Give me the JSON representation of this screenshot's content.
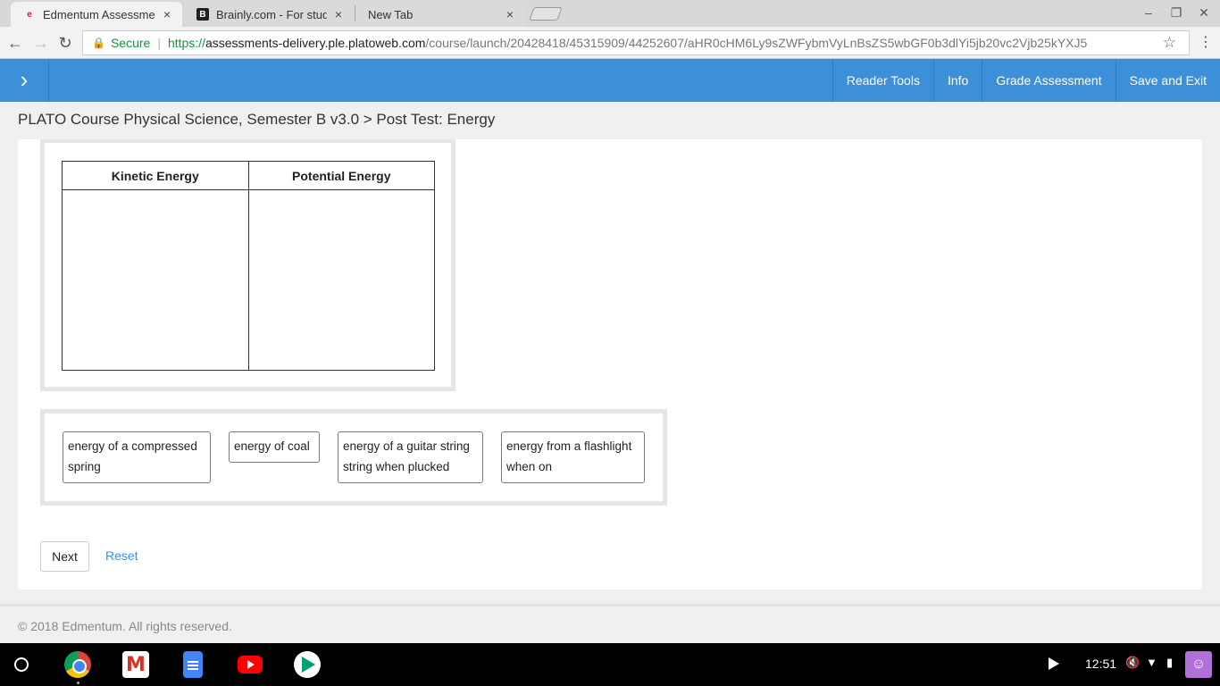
{
  "browser": {
    "tabs": [
      {
        "title": "Edmentum Assessments",
        "icon": "edmentum-favicon",
        "close": "×"
      },
      {
        "title": "Brainly.com - For students",
        "icon": "brainly-favicon",
        "close": "×"
      },
      {
        "title": "New Tab",
        "close": "×"
      }
    ],
    "window_controls": {
      "minimize": "–",
      "restore": "❐",
      "close": "✕"
    },
    "nav": {
      "back": "←",
      "forward": "→",
      "reload": "↻"
    },
    "address": {
      "secure_label": "Secure",
      "url_scheme": "https://",
      "url_host": "assessments-delivery.ple.platoweb.com",
      "url_path": "/course/launch/20428418/45315909/44252607/aHR0cHM6Ly9sZWFybmVyLnBsZS5wbGF0b3dlYi5jb20vc2Vjb25kYXJ5"
    },
    "star": "☆",
    "menu": "⋮"
  },
  "app_header": {
    "menu_toggle": "›",
    "nav_items": [
      "Reader Tools",
      "Info",
      "Grade Assessment",
      "Save and Exit"
    ]
  },
  "breadcrumb": "PLATO Course Physical Science, Semester B v3.0 > Post Test: Energy",
  "question": {
    "columns": [
      "Kinetic Energy",
      "Potential Energy"
    ],
    "tiles": [
      "energy of a compressed spring",
      "energy of coal",
      "energy of a guitar string string when plucked",
      "energy from a flashlight when on"
    ]
  },
  "actions": {
    "next": "Next",
    "reset": "Reset"
  },
  "footer": "© 2018 Edmentum. All rights reserved.",
  "shelf": {
    "apps": [
      "chrome-icon",
      "gmail-icon",
      "docs-icon",
      "youtube-icon",
      "play-store-icon"
    ],
    "clock": "12:51"
  },
  "colors": {
    "header_blue": "#3d8fd8",
    "link_blue": "#3d8fd8"
  }
}
